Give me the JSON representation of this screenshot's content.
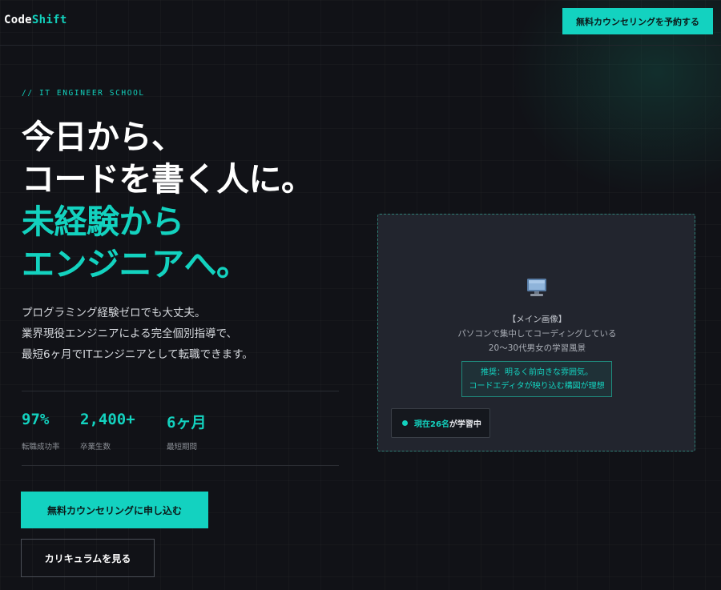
{
  "header": {
    "logo_part1": "Code",
    "logo_part2": "Shift",
    "cta_label": "無料カウンセリングを予約する"
  },
  "hero": {
    "eyebrow": "// IT ENGINEER SCHOOL",
    "headline_lines": [
      "今日から、",
      "コードを書く人に。"
    ],
    "headline_accent_lines": [
      "未経験から",
      "エンジニアへ。"
    ],
    "lead_lines": [
      "プログラミング経験ゼロでも大丈夫。",
      "業界現役エンジニアによる完全個別指導で、",
      "最短6ヶ月でITエンジニアとして転職できます。"
    ],
    "stats": [
      {
        "value": "97%",
        "label": "転職成功率"
      },
      {
        "value": "2,400+",
        "label": "卒業生数"
      },
      {
        "value": "6ヶ月",
        "label": "最短期間"
      }
    ],
    "primary_button": "無料カウンセリングに申し込む",
    "secondary_button": "カリキュラムを見る"
  },
  "image_placeholder": {
    "icon": "monitor-icon",
    "title": "【メイン画像】",
    "line1": "パソコンで集中してコーディングしている",
    "line2": "20〜30代男女の学習風景",
    "recommend_lines": [
      "推奨：明るく前向きな雰囲気。",
      "コードエディタが映り込む構図が理想"
    ],
    "live_badge": {
      "count": "現在26名",
      "rest": "が学習中"
    }
  },
  "colors": {
    "accent": "#13d2bf",
    "background": "#111217",
    "card": "#22252e"
  }
}
